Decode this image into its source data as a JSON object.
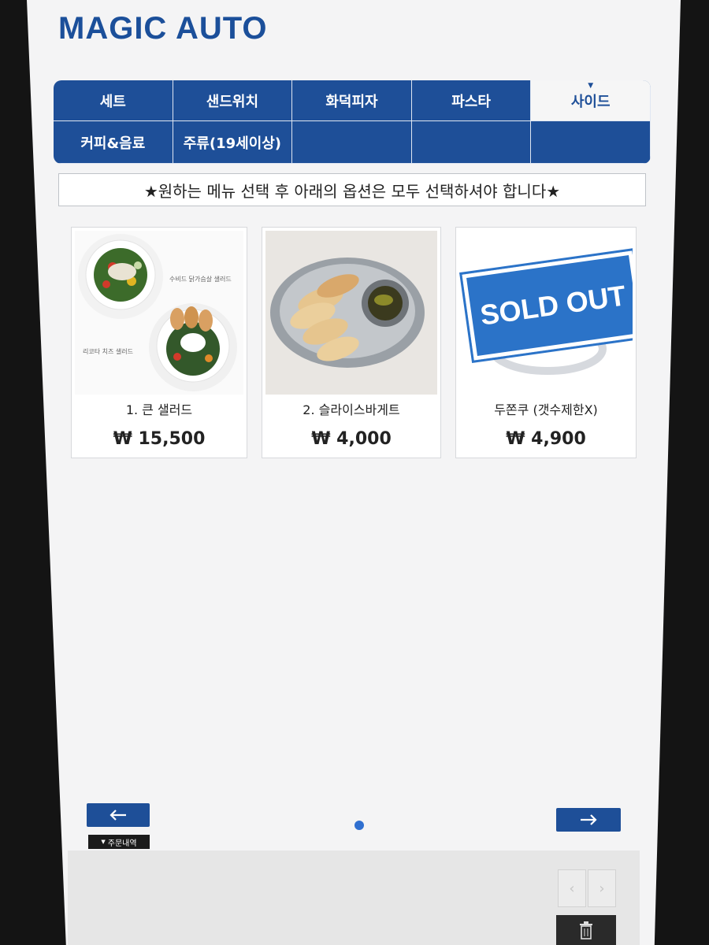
{
  "app": {
    "brand": "MAGIC AUTO"
  },
  "tabs": [
    {
      "label": "세트",
      "active": false
    },
    {
      "label": "샌드위치",
      "active": false
    },
    {
      "label": "화덕피자",
      "active": false
    },
    {
      "label": "파스타",
      "active": false
    },
    {
      "label": "사이드",
      "active": true
    },
    {
      "label": "커피&음료",
      "active": false
    },
    {
      "label": "주류(19세이상)",
      "active": false
    },
    {
      "label": "",
      "active": false
    },
    {
      "label": "",
      "active": false
    },
    {
      "label": "",
      "active": false
    }
  ],
  "notice": "★원하는 메뉴 선택 후 아래의 옵션은 모두 선택하셔야 합니다★",
  "menu": [
    {
      "name": "1. 큰 샐러드",
      "price": "₩ 15,500",
      "image_captions": [
        "수비드 닭가슴살 샐러드",
        "리코타 치즈 샐러드"
      ]
    },
    {
      "name": "2. 슬라이스바게트",
      "price": "₩ 4,000"
    },
    {
      "name": "두쫀쿠 (갯수제한X)",
      "price": "₩ 4,900",
      "stamp": "SOLD OUT"
    }
  ],
  "footer": {
    "order_history": "주문내역"
  },
  "colors": {
    "primary": "#1e4f98",
    "accent_dot": "#2f6fd0",
    "stamp": "#2b73c8"
  },
  "icons": [
    "arrow-left-icon",
    "arrow-right-icon",
    "chevron-left-icon",
    "chevron-right-icon",
    "trash-icon",
    "caret-down-icon"
  ]
}
